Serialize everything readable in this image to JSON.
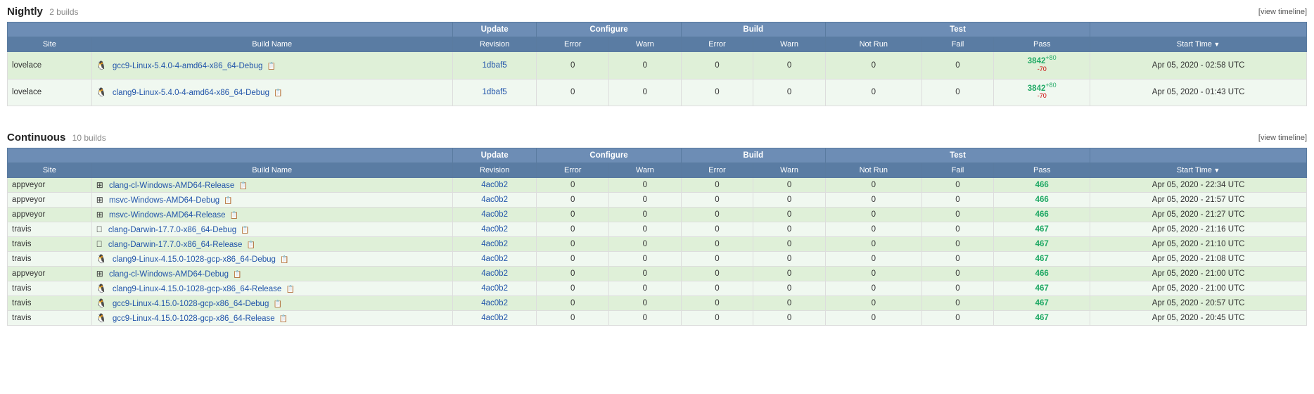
{
  "nightly": {
    "title": "Nightly",
    "subtitle": "2 builds",
    "view_timeline": "[view timeline]",
    "headers": {
      "update": "Update",
      "configure": "Configure",
      "build": "Build",
      "test": "Test"
    },
    "sub_headers": [
      "Site",
      "Build Name",
      "Revision",
      "Error",
      "Warn",
      "Error",
      "Warn",
      "Not Run",
      "Fail",
      "Pass",
      "Start Time"
    ],
    "rows": [
      {
        "site": "lovelace",
        "icon": "tux",
        "build_name": "gcc9-Linux-5.4.0-4-amd64-x86_64-Debug",
        "revision": "1dbaf5",
        "cfg_error": "0",
        "cfg_warn": "0",
        "bld_error": "0",
        "bld_warn": "0",
        "not_run": "0",
        "fail": "0",
        "pass": "3842",
        "pass_plus": "+80",
        "pass_minus": "-70",
        "start_time": "Apr 05, 2020 - 02:58 UTC",
        "row_class": "row-green"
      },
      {
        "site": "lovelace",
        "icon": "tux",
        "build_name": "clang9-Linux-5.4.0-4-amd64-x86_64-Debug",
        "revision": "1dbaf5",
        "cfg_error": "0",
        "cfg_warn": "0",
        "bld_error": "0",
        "bld_warn": "0",
        "not_run": "0",
        "fail": "0",
        "pass": "3842",
        "pass_plus": "+80",
        "pass_minus": "-70",
        "start_time": "Apr 05, 2020 - 01:43 UTC",
        "row_class": "row-light"
      }
    ]
  },
  "continuous": {
    "title": "Continuous",
    "subtitle": "10 builds",
    "view_timeline": "[view timeline]",
    "rows": [
      {
        "site": "appveyor",
        "icon": "win",
        "build_name": "clang-cl-Windows-AMD64-Release",
        "revision": "4ac0b2",
        "cfg_error": "0",
        "cfg_warn": "0",
        "bld_error": "0",
        "bld_warn": "0",
        "not_run": "0",
        "fail": "0",
        "pass": "466",
        "pass_plus": "",
        "pass_minus": "",
        "start_time": "Apr 05, 2020 - 22:34 UTC",
        "row_class": "row-green"
      },
      {
        "site": "appveyor",
        "icon": "win",
        "build_name": "msvc-Windows-AMD64-Debug",
        "revision": "4ac0b2",
        "cfg_error": "0",
        "cfg_warn": "0",
        "bld_error": "0",
        "bld_warn": "0",
        "not_run": "0",
        "fail": "0",
        "pass": "466",
        "pass_plus": "",
        "pass_minus": "",
        "start_time": "Apr 05, 2020 - 21:57 UTC",
        "row_class": "row-light"
      },
      {
        "site": "appveyor",
        "icon": "win",
        "build_name": "msvc-Windows-AMD64-Release",
        "revision": "4ac0b2",
        "cfg_error": "0",
        "cfg_warn": "0",
        "bld_error": "0",
        "bld_warn": "0",
        "not_run": "0",
        "fail": "0",
        "pass": "466",
        "pass_plus": "",
        "pass_minus": "",
        "start_time": "Apr 05, 2020 - 21:27 UTC",
        "row_class": "row-green"
      },
      {
        "site": "travis",
        "icon": "apple",
        "build_name": "clang-Darwin-17.7.0-x86_64-Debug",
        "revision": "4ac0b2",
        "cfg_error": "0",
        "cfg_warn": "0",
        "bld_error": "0",
        "bld_warn": "0",
        "not_run": "0",
        "fail": "0",
        "pass": "467",
        "pass_plus": "",
        "pass_minus": "",
        "start_time": "Apr 05, 2020 - 21:16 UTC",
        "row_class": "row-light"
      },
      {
        "site": "travis",
        "icon": "apple",
        "build_name": "clang-Darwin-17.7.0-x86_64-Release",
        "revision": "4ac0b2",
        "cfg_error": "0",
        "cfg_warn": "0",
        "bld_error": "0",
        "bld_warn": "0",
        "not_run": "0",
        "fail": "0",
        "pass": "467",
        "pass_plus": "",
        "pass_minus": "",
        "start_time": "Apr 05, 2020 - 21:10 UTC",
        "row_class": "row-green"
      },
      {
        "site": "travis",
        "icon": "tux",
        "build_name": "clang9-Linux-4.15.0-1028-gcp-x86_64-Debug",
        "revision": "4ac0b2",
        "cfg_error": "0",
        "cfg_warn": "0",
        "bld_error": "0",
        "bld_warn": "0",
        "not_run": "0",
        "fail": "0",
        "pass": "467",
        "pass_plus": "",
        "pass_minus": "",
        "start_time": "Apr 05, 2020 - 21:08 UTC",
        "row_class": "row-light"
      },
      {
        "site": "appveyor",
        "icon": "win",
        "build_name": "clang-cl-Windows-AMD64-Debug",
        "revision": "4ac0b2",
        "cfg_error": "0",
        "cfg_warn": "0",
        "bld_error": "0",
        "bld_warn": "0",
        "not_run": "0",
        "fail": "0",
        "pass": "466",
        "pass_plus": "",
        "pass_minus": "",
        "start_time": "Apr 05, 2020 - 21:00 UTC",
        "row_class": "row-green"
      },
      {
        "site": "travis",
        "icon": "tux",
        "build_name": "clang9-Linux-4.15.0-1028-gcp-x86_64-Release",
        "revision": "4ac0b2",
        "cfg_error": "0",
        "cfg_warn": "0",
        "bld_error": "0",
        "bld_warn": "0",
        "not_run": "0",
        "fail": "0",
        "pass": "467",
        "pass_plus": "",
        "pass_minus": "",
        "start_time": "Apr 05, 2020 - 21:00 UTC",
        "row_class": "row-light"
      },
      {
        "site": "travis",
        "icon": "tux",
        "build_name": "gcc9-Linux-4.15.0-1028-gcp-x86_64-Debug",
        "revision": "4ac0b2",
        "cfg_error": "0",
        "cfg_warn": "0",
        "bld_error": "0",
        "bld_warn": "0",
        "not_run": "0",
        "fail": "0",
        "pass": "467",
        "pass_plus": "",
        "pass_minus": "",
        "start_time": "Apr 05, 2020 - 20:57 UTC",
        "row_class": "row-green"
      },
      {
        "site": "travis",
        "icon": "tux",
        "build_name": "gcc9-Linux-4.15.0-1028-gcp-x86_64-Release",
        "revision": "4ac0b2",
        "cfg_error": "0",
        "cfg_warn": "0",
        "bld_error": "0",
        "bld_warn": "0",
        "not_run": "0",
        "fail": "0",
        "pass": "467",
        "pass_plus": "",
        "pass_minus": "",
        "start_time": "Apr 05, 2020 - 20:45 UTC",
        "row_class": "row-light"
      }
    ]
  },
  "icons": {
    "tux": "🐧",
    "win": "⊞",
    "apple": "🍎",
    "copy": "📋"
  }
}
